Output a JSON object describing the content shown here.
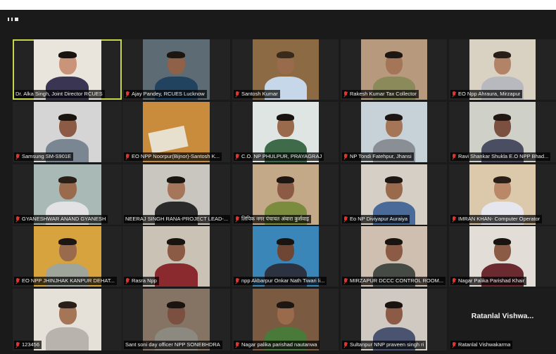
{
  "participants": [
    {
      "name": "Dr. Alka Singh, Joint Director RCUES",
      "muted": false,
      "active": true,
      "bg": "#e9e4dc",
      "shirt": "#3b3554",
      "skin": "#c99478",
      "hair": "#1a1210"
    },
    {
      "name": "Ajay Pandey, RCUES Lucknow",
      "muted": true,
      "bg": "#5c6b74",
      "shirt": "#22435f",
      "skin": "#8f6148",
      "hair": "#1c1510"
    },
    {
      "name": "Santosh Kumar",
      "muted": true,
      "bg": "#8c6a43",
      "shirt": "#c7d7ea",
      "skin": "#9a6a4c",
      "hair": "#3a2a1c"
    },
    {
      "name": "Rakesh Kumar Tax Collector",
      "muted": true,
      "bg": "#b79a7e",
      "shirt": "#8a8a5a",
      "skin": "#a47556",
      "hair": "#1d1612"
    },
    {
      "name": "EO Npp Ahraura, Mirzapur",
      "muted": true,
      "bg": "#d9d2c3",
      "shirt": "#b8b8bf",
      "skin": "#b28366",
      "hair": "#2a1f18"
    },
    {
      "name": "Samsung SM-S901E",
      "muted": true,
      "bg": "#d5d5d5",
      "shirt": "#7a8793",
      "skin": "#8c5b45",
      "hair": "#1a1410"
    },
    {
      "name": "EO NPP Noorpur(Bijnor)-Santosh K...",
      "muted": true,
      "bg": "#c98c3d",
      "shirt": "#e8e0cf",
      "skin": "#a07050",
      "hair": "#1d1612",
      "empty": true
    },
    {
      "name": "C.O. NP PHULPUR, PRAYAGRAJ",
      "muted": true,
      "bg": "#dfe5e2",
      "shirt": "#3f6b4a",
      "skin": "#9a6a4c",
      "hair": "#1a1410"
    },
    {
      "name": "NP Tondi Fatehpur, Jhansi",
      "muted": true,
      "bg": "#c7d2d8",
      "shirt": "#8a8f96",
      "skin": "#a47556",
      "hair": "#1d1612"
    },
    {
      "name": "Ravi Shankar Shukla E.O NPP Bhad...",
      "muted": true,
      "bg": "#cfd0c8",
      "shirt": "#4b4d62",
      "skin": "#7b5040",
      "hair": "#221813"
    },
    {
      "name": "GYANESHWAR  ANAND GYANESH",
      "muted": true,
      "bg": "#a9b9b5",
      "shirt": "#e2e2e4",
      "skin": "#9a6a4c",
      "hair": "#2a2018"
    },
    {
      "name": "NEERAJ SINGH RANA-PROJECT LEAD-...",
      "muted": false,
      "bg": "#c9c6c0",
      "shirt": "#2a2a2a",
      "skin": "#a6765a",
      "hair": "#1a1410"
    },
    {
      "name": "लिपिक नगर पंचायत अंबारा कुर्सवाइ",
      "muted": true,
      "bg": "#c4a988",
      "shirt": "#7b8c3f",
      "skin": "#8c5b45",
      "hair": "#1d1612"
    },
    {
      "name": "Eo NP Diviyapur Auraiya",
      "muted": true,
      "bg": "#d6cfc5",
      "shirt": "#4a6a9a",
      "skin": "#9a6a4c",
      "hair": "#1d1612"
    },
    {
      "name": "IMRAN KHAN- Computer Operator",
      "muted": true,
      "bg": "#dcc8aa",
      "shirt": "#e6e6ee",
      "skin": "#b88868",
      "hair": "#2a1f18"
    },
    {
      "name": "EO NPP JHINJHAK KANPUR DEHAT...",
      "muted": true,
      "bg": "#d6a33e",
      "shirt": "#9fa59a",
      "skin": "#9a6a4c",
      "hair": "#1d1612"
    },
    {
      "name": "Rasra Npp",
      "muted": true,
      "bg": "#c9c2b5",
      "shirt": "#8a2a2e",
      "skin": "#8c5b45",
      "hair": "#1a1410"
    },
    {
      "name": "npp Akbarpur Onkar Nath Tiwari li...",
      "muted": true,
      "bg": "#3a86b9",
      "shirt": "#2c3240",
      "skin": "#6f4534",
      "hair": "#1a1410"
    },
    {
      "name": "MIRZAPUR DCCC CONTROL ROOM...",
      "muted": true,
      "bg": "#cfbfb0",
      "shirt": "#464a45",
      "skin": "#8c5b45",
      "hair": "#1a1410"
    },
    {
      "name": "Nagar Palika Parishad Khair",
      "muted": true,
      "bg": "#e2ddd6",
      "shirt": "#6a2a30",
      "skin": "#8c5b45",
      "hair": "#1a1410"
    },
    {
      "name": "123456",
      "muted": true,
      "bg": "#e6e1d8",
      "shirt": "#b9b3ad",
      "skin": "#a47556",
      "hair": "#2a1f18"
    },
    {
      "name": "Sant soni day officer NPP SONEBHDRA",
      "muted": false,
      "bg": "#857463",
      "shirt": "#8c8a80",
      "skin": "#7b5040",
      "hair": "#1a1410"
    },
    {
      "name": "Nagar palika parishad nautanwa",
      "muted": true,
      "bg": "#7a5a40",
      "shirt": "#4a7a3a",
      "skin": "#9a6a4c",
      "hair": "#1d1612"
    },
    {
      "name": "Sultanpur NNP praveen singh ri",
      "muted": true,
      "bg": "#cfc9c1",
      "shirt": "#4a5470",
      "skin": "#8c5b45",
      "hair": "#1a1410"
    },
    {
      "name": "Ratanlal Vishwakarma",
      "muted": true,
      "video_off": true,
      "display_name": "Ratanlal  Vishwa..."
    }
  ],
  "colors": {
    "background": "#1a1a1a",
    "tile": "#232323",
    "active_outline": "#c8d64a",
    "muted_icon": "#e0352e"
  },
  "icons": {
    "view": "grid-view-icon",
    "muted": "mic-muted-icon"
  }
}
